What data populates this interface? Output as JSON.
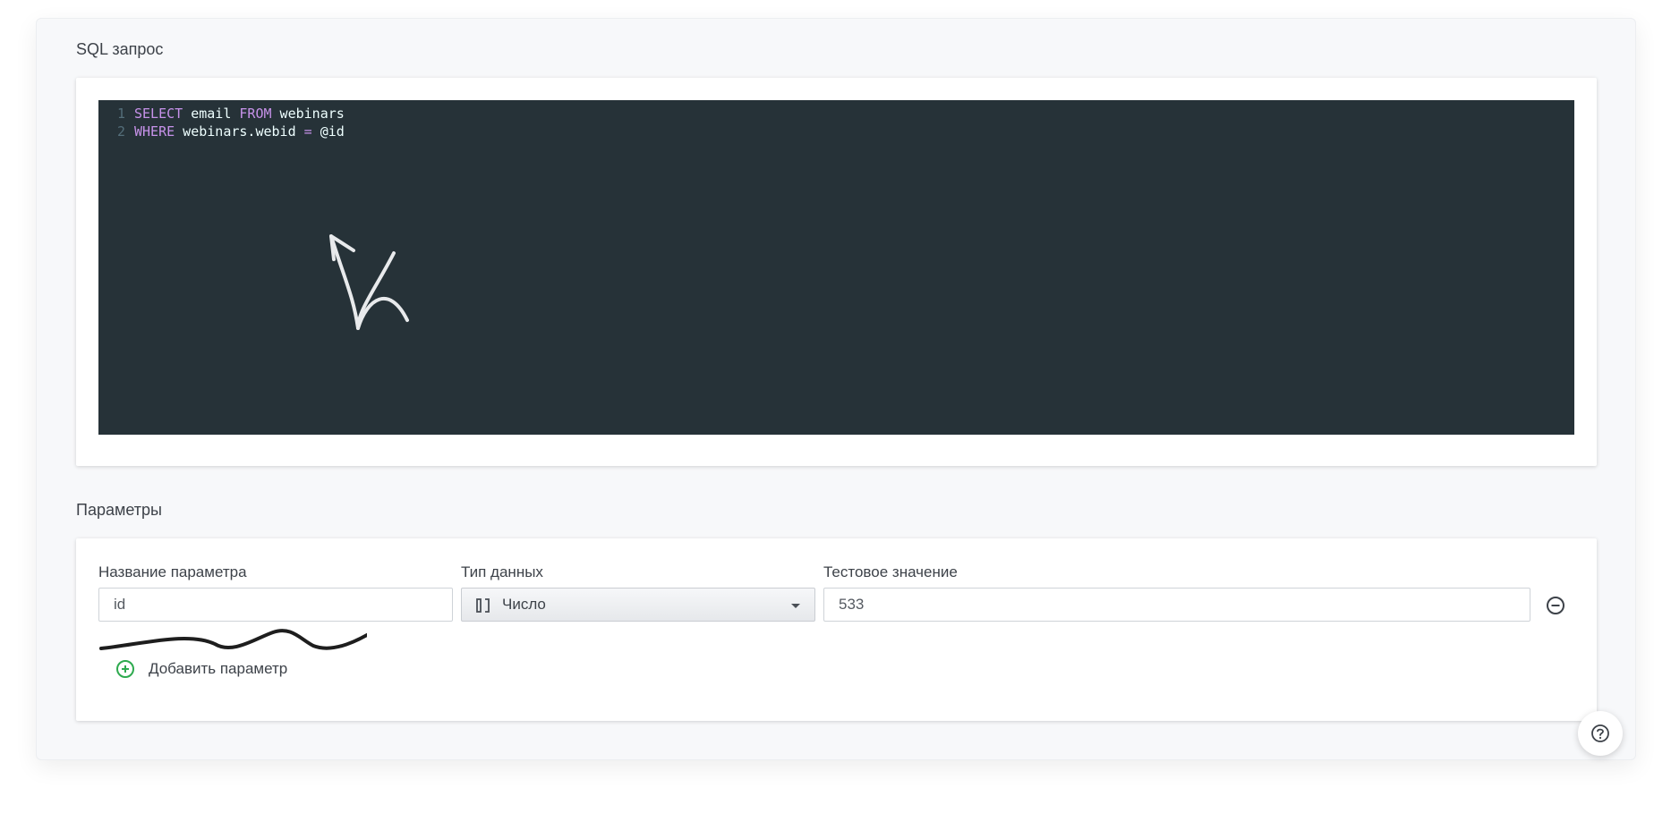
{
  "sql_section": {
    "title": "SQL запрос",
    "lines": [
      {
        "number": "1",
        "tokens": [
          {
            "text": "SELECT",
            "kind": "keyword"
          },
          {
            "text": " email ",
            "kind": "plain"
          },
          {
            "text": "FROM",
            "kind": "keyword"
          },
          {
            "text": " webinars",
            "kind": "plain"
          }
        ]
      },
      {
        "number": "2",
        "tokens": [
          {
            "text": "WHERE",
            "kind": "keyword"
          },
          {
            "text": " webinars.webid ",
            "kind": "plain"
          },
          {
            "text": "=",
            "kind": "keyword"
          },
          {
            "text": " @id",
            "kind": "plain"
          }
        ]
      }
    ]
  },
  "params_section": {
    "title": "Параметры",
    "labels": {
      "name": "Название параметра",
      "type": "Тип данных",
      "test_value": "Тестовое значение"
    },
    "row": {
      "name": "id",
      "type": "Число",
      "test_value": "533"
    },
    "add_label": "Добавить параметр"
  },
  "icons": {
    "type": "number-type-icon",
    "remove": "minus-circle-icon",
    "add": "plus-circle-icon",
    "help": "question-circle-icon"
  },
  "colors": {
    "editor_bg": "#263238",
    "keyword": "#c792ea",
    "add_icon": "#2eaa4f"
  }
}
